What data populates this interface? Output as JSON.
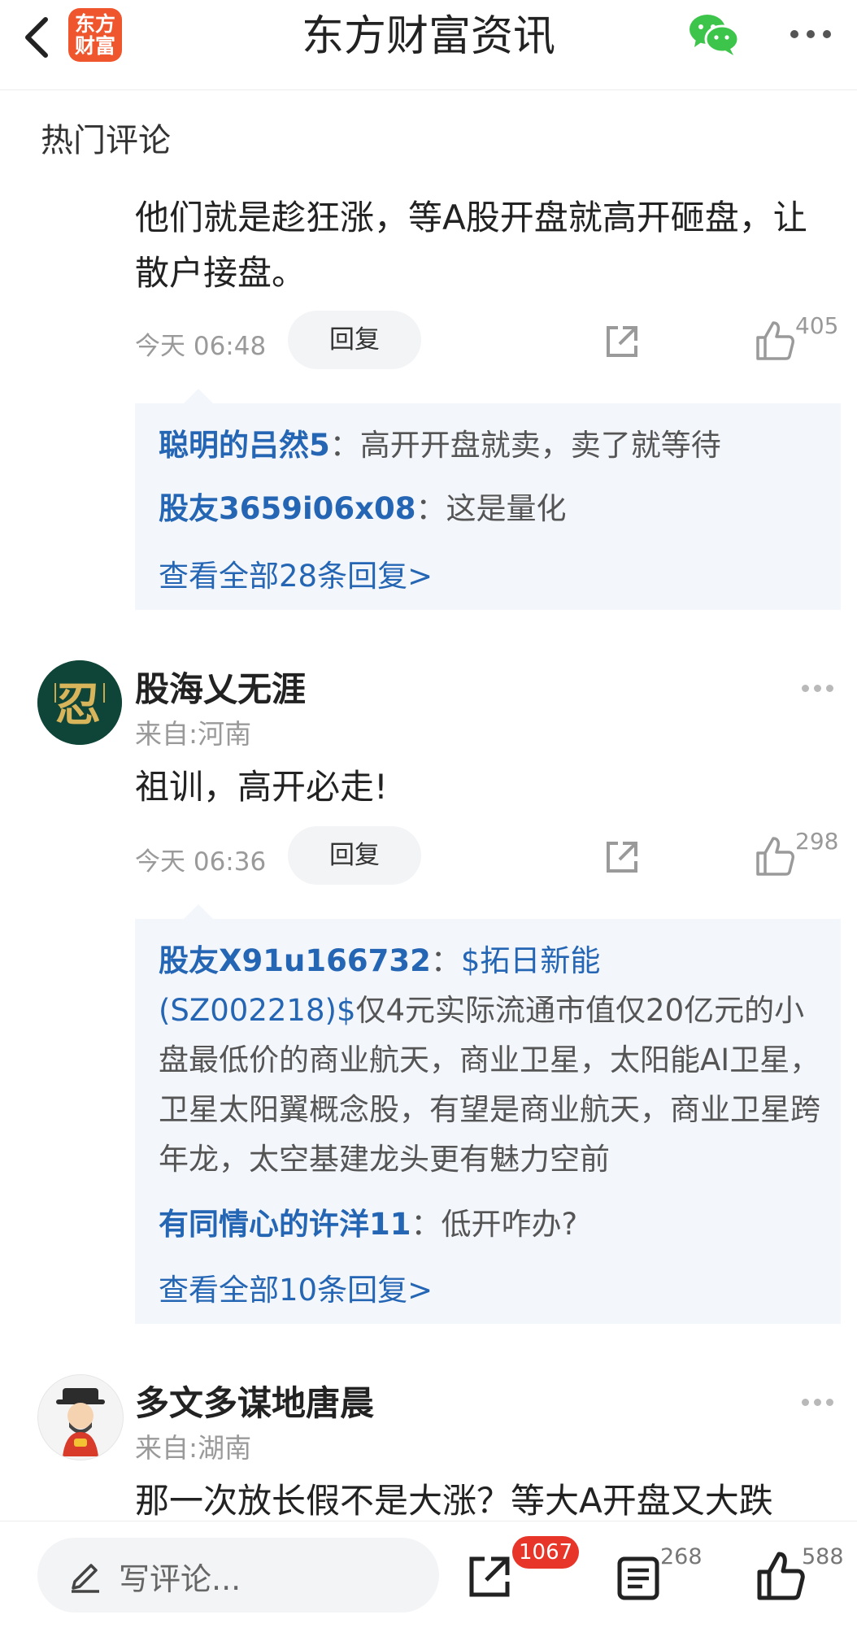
{
  "header": {
    "title": "东方财富资讯",
    "logo_line1": "东方",
    "logo_line2": "财富"
  },
  "section_title": "热门评论",
  "comments": [
    {
      "text": "他们就是趁狂涨，等A股开盘就高开砸盘，让散户接盘。",
      "time": "今天 06:48",
      "reply_label": "回复",
      "likes": "405",
      "replies": [
        {
          "user": "聪明的吕然5",
          "sep": "：",
          "text": "高开开盘就卖，卖了就等待"
        },
        {
          "user": "股友3659i06x08",
          "sep": "：",
          "text": "这是量化"
        }
      ],
      "view_all": "查看全部28条回复>"
    },
    {
      "user": "股海乂无涯",
      "location": "来自:河南",
      "text": "祖训，高开必走!",
      "time": "今天 06:36",
      "reply_label": "回复",
      "likes": "298",
      "replies": [
        {
          "user": "股友X91u166732",
          "sep": "：",
          "link": "$拓日新能(SZ002218)$",
          "text": "仅4元实际流通市值仅20亿元的小盘最低价的商业航天，商业卫星，太阳能AI卫星，卫星太阳翼概念股，有望是商业航天，商业卫星跨年龙，太空基建龙头更有魅力空前"
        },
        {
          "user": "有同情心的许洋11",
          "sep": "：",
          "text": "低开咋办?"
        }
      ],
      "view_all": "查看全部10条回复>"
    },
    {
      "user": "多文多谋地唐晨",
      "location": "来自:湖南",
      "text": "那一次放长假不是大涨？等大A开盘又大跌"
    }
  ],
  "bottom": {
    "input_placeholder": "写评论...",
    "share_badge": "1067",
    "comments_count": "268",
    "likes_count": "588"
  },
  "colors": {
    "accent_blue": "#2566b4",
    "brand_orange": "#f0562d",
    "badge_red": "#e8352a",
    "wechat_green": "#3dc44a"
  }
}
